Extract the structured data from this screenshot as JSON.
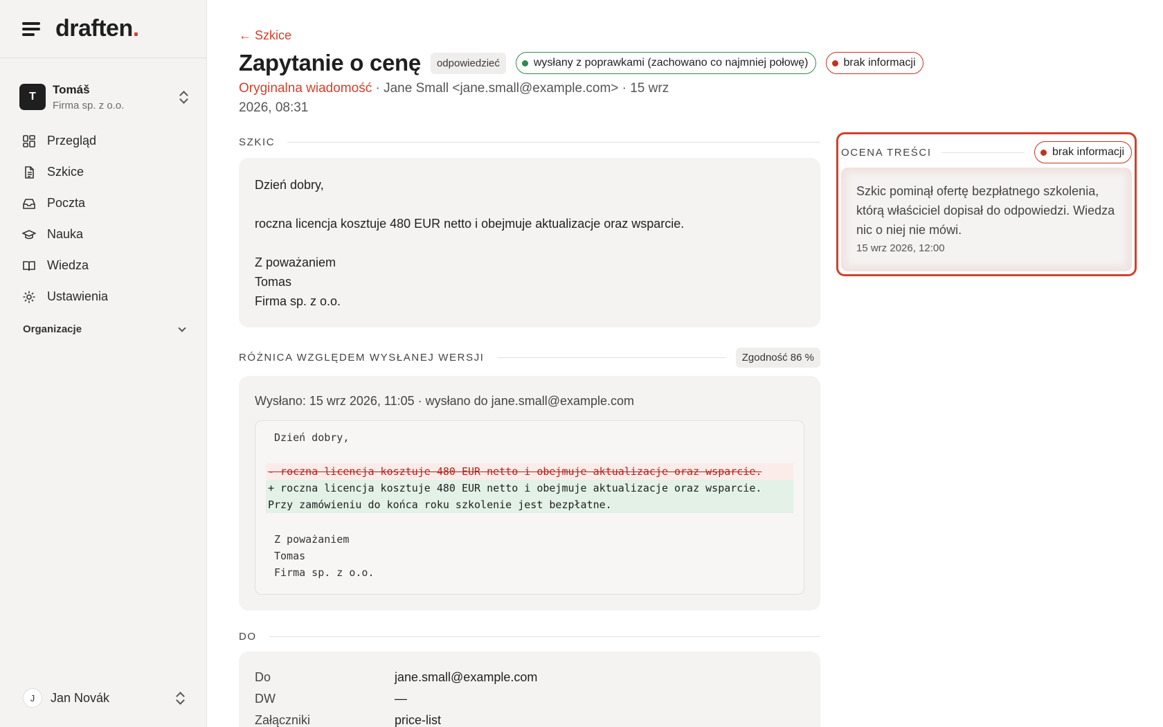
{
  "brand": {
    "name": "draften",
    "dot": "."
  },
  "org": {
    "initial": "T",
    "name": "Tomáš",
    "company": "Firma sp. z o.o."
  },
  "nav": [
    {
      "label": "Przegląd",
      "icon": "dashboard-icon"
    },
    {
      "label": "Szkice",
      "icon": "document-icon"
    },
    {
      "label": "Poczta",
      "icon": "inbox-icon"
    },
    {
      "label": "Nauka",
      "icon": "graduation-cap-icon"
    },
    {
      "label": "Wiedza",
      "icon": "book-icon"
    },
    {
      "label": "Ustawienia",
      "icon": "gear-icon"
    }
  ],
  "organizations_label": "Organizacje",
  "user": {
    "initial": "J",
    "name": "Jan Novák"
  },
  "header": {
    "back_label": "← Szkice",
    "title": "Zapytanie o cenę",
    "type_chip": "odpowiedzieć",
    "status_pill": "wysłany z poprawkami (zachowano co najmniej połowę)",
    "info_pill": "brak informacji",
    "original_link": "Oryginalna wiadomość",
    "meta": " · Jane Small <jane.small@example.com> · 15 wrz 2026, 08:31"
  },
  "draft": {
    "section_label": "SZKIC",
    "greeting": "Dzień dobry,",
    "body": "roczna licencja kosztuje 480 EUR netto i obejmuje aktualizacje oraz wsparcie.",
    "sign_1": "Z poważaniem",
    "sign_2": "Tomas",
    "sign_3": "Firma sp. z o.o."
  },
  "diff": {
    "section_label": "RÓŻNICA WZGLĘDEM WYSŁANEJ WERSJI",
    "score": "Zgodność 86 %",
    "sent_info": "Wysłano: 15 wrz 2026, 11:05 · wysłano do jane.small@example.com",
    "lines": {
      "l1": "Dzień dobry,",
      "del": "- roczna licencja kosztuje 480 EUR netto i obejmuje aktualizacje oraz wsparcie.",
      "add1": "+ roczna licencja kosztuje 480 EUR netto i obejmuje aktualizacje oraz wsparcie.",
      "add2": "Przy zamówieniu do końca roku szkolenie jest bezpłatne.",
      "s1": "Z poważaniem",
      "s2": "Tomas",
      "s3": "Firma sp. z o.o."
    }
  },
  "recipients": {
    "section_label": "DO",
    "rows": [
      {
        "key": "Do",
        "value": "jane.small@example.com"
      },
      {
        "key": "DW",
        "value": "—"
      },
      {
        "key": "Załączniki",
        "value": "price-list"
      }
    ]
  },
  "assessment": {
    "title": "OCENA TREŚCI",
    "pill": "brak informacji",
    "text": "Szkic pominął ofertę bezpłatnego szkolenia, którą właściciel dopisał do odpowiedzi. Wiedza nic o niej nie mówi.",
    "time": "15 wrz 2026, 12:00"
  },
  "colors": {
    "accent": "#d2402a",
    "success": "#2f8a4e",
    "sidebar_bg": "#f4f3f1",
    "card_bg": "#f4f3f1"
  }
}
